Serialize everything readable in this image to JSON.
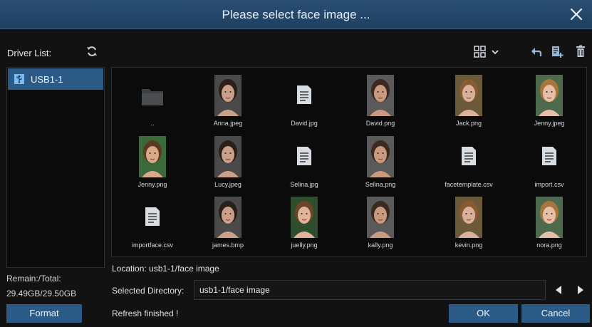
{
  "dialog": {
    "title": "Please select face image ...",
    "close_icon": "close-icon"
  },
  "sidebar": {
    "driver_list_label": "Driver List:",
    "drives": [
      {
        "label": "USB1-1",
        "icon": "usb-icon",
        "selected": true
      }
    ],
    "remain_label": "Remain:/Total:",
    "remain_value": "29.49GB/29.50GB",
    "format_label": "Format"
  },
  "toolbar": {
    "view_icon": "grid-view-icon",
    "back_icon": "back-icon",
    "new_folder_icon": "add-file-icon",
    "delete_icon": "trash-icon"
  },
  "files": [
    {
      "name": "..",
      "kind": "folder"
    },
    {
      "name": "Anna.jpeg",
      "kind": "image"
    },
    {
      "name": "David.jpg",
      "kind": "document"
    },
    {
      "name": "David.png",
      "kind": "image"
    },
    {
      "name": "Jack.png",
      "kind": "image"
    },
    {
      "name": "Jenny.jpeg",
      "kind": "image"
    },
    {
      "name": "Jenny.png",
      "kind": "image"
    },
    {
      "name": "Lucy.jpeg",
      "kind": "image"
    },
    {
      "name": "Selina.jpg",
      "kind": "document"
    },
    {
      "name": "Selina.png",
      "kind": "image"
    },
    {
      "name": "facetemplate.csv",
      "kind": "document"
    },
    {
      "name": "import.csv",
      "kind": "document"
    },
    {
      "name": "importface.csv",
      "kind": "document"
    },
    {
      "name": "james.bmp",
      "kind": "image"
    },
    {
      "name": "juelly.png",
      "kind": "image"
    },
    {
      "name": "kally.png",
      "kind": "image"
    },
    {
      "name": "kevin.png",
      "kind": "image"
    },
    {
      "name": "nora.png",
      "kind": "image"
    }
  ],
  "location": "Location:  usb1-1/face image",
  "selected_directory": {
    "label": "Selected Directory:",
    "value": "usb1-1/face image"
  },
  "status": "Refresh finished !",
  "buttons": {
    "ok": "OK",
    "cancel": "Cancel"
  },
  "colors": {
    "accent": "#2b5a86",
    "title_bar": "#234a70",
    "background": "#121212"
  }
}
